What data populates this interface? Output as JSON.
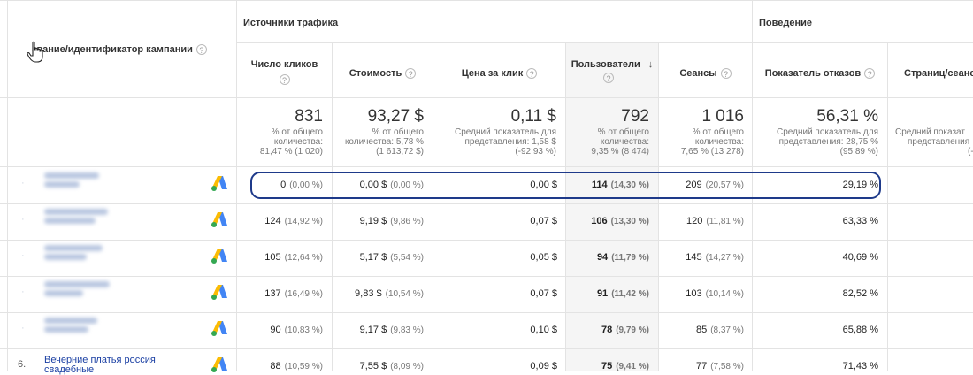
{
  "header": {
    "campaign_column": "Название/идентификатор кампании",
    "campaign_column_visible": "звание/идентификатор кампании",
    "groups": {
      "traffic_sources": "Источники трафика",
      "behavior": "Поведение"
    },
    "columns": {
      "clicks": "Число кликов",
      "cost": "Стоимость",
      "cpc": "Цена за клик",
      "users": "Пользователи",
      "sessions": "Сеансы",
      "bounce_rate": "Показатель отказов",
      "pages_per_session": "Страниц/сеанс"
    },
    "help_icon": "?",
    "sort_arrow": "↓"
  },
  "summary": {
    "clicks": {
      "value": "831",
      "sub1": "% от общего",
      "sub2": "количества:",
      "sub3": "81,47 % (1 020)"
    },
    "cost": {
      "value": "93,27 $",
      "sub1": "% от общего",
      "sub2": "количества: 5,78 %",
      "sub3": "(1 613,72 $)"
    },
    "cpc": {
      "value": "0,11 $",
      "sub1": "Средний показатель для",
      "sub2": "представления: 1,58 $",
      "sub3": "(-92,93 %)"
    },
    "users": {
      "value": "792",
      "sub1": "% от общего",
      "sub2": "количества:",
      "sub3": "9,35 % (8 474)"
    },
    "sessions": {
      "value": "1 016",
      "sub1": "% от общего",
      "sub2": "количества:",
      "sub3": "7,65 % (13 278)"
    },
    "bounce_rate": {
      "value": "56,31 %",
      "sub1": "Средний показатель для",
      "sub2": "представления: 28,75 %",
      "sub3": "(95,89 %)"
    },
    "pages_per_session": {
      "sub1": "Средний показат",
      "sub2": "представления",
      "sub3": "(-"
    }
  },
  "rows": [
    {
      "num": "",
      "clicks": "0",
      "clicks_pct": "(0,00 %)",
      "cost": "0,00 $",
      "cost_pct": "(0,00 %)",
      "cpc": "0,00 $",
      "users": "114",
      "users_pct": "(14,30 %)",
      "sessions": "209",
      "sessions_pct": "(20,57 %)",
      "bounce": "29,19 %"
    },
    {
      "num": "",
      "clicks": "124",
      "clicks_pct": "(14,92 %)",
      "cost": "9,19 $",
      "cost_pct": "(9,86 %)",
      "cpc": "0,07 $",
      "users": "106",
      "users_pct": "(13,30 %)",
      "sessions": "120",
      "sessions_pct": "(11,81 %)",
      "bounce": "63,33 %"
    },
    {
      "num": "",
      "clicks": "105",
      "clicks_pct": "(12,64 %)",
      "cost": "5,17 $",
      "cost_pct": "(5,54 %)",
      "cpc": "0,05 $",
      "users": "94",
      "users_pct": "(11,79 %)",
      "sessions": "145",
      "sessions_pct": "(14,27 %)",
      "bounce": "40,69 %"
    },
    {
      "num": "",
      "clicks": "137",
      "clicks_pct": "(16,49 %)",
      "cost": "9,83 $",
      "cost_pct": "(10,54 %)",
      "cpc": "0,07 $",
      "users": "91",
      "users_pct": "(11,42 %)",
      "sessions": "103",
      "sessions_pct": "(10,14 %)",
      "bounce": "82,52 %"
    },
    {
      "num": "",
      "clicks": "90",
      "clicks_pct": "(10,83 %)",
      "cost": "9,17 $",
      "cost_pct": "(9,83 %)",
      "cpc": "0,10 $",
      "users": "78",
      "users_pct": "(9,79 %)",
      "sessions": "85",
      "sessions_pct": "(8,37 %)",
      "bounce": "65,88 %"
    },
    {
      "num": "6.",
      "campaign": "Вечерние платья россия",
      "campaign2": "свадебные",
      "clicks": "88",
      "clicks_pct": "(10,59 %)",
      "cost": "7,55 $",
      "cost_pct": "(8,09 %)",
      "cpc": "0,09 $",
      "users": "75",
      "users_pct": "(9,41 %)",
      "sessions": "77",
      "sessions_pct": "(7,58 %)",
      "bounce": "71,43 %"
    }
  ],
  "colors": {
    "highlight": "#1e3a8a",
    "users_column_bg": "#f5f5f5",
    "google_ads_blue": "#4285f4",
    "google_ads_yellow": "#fbbc04"
  },
  "icons": {
    "google_ads": "google-ads-icon",
    "cursor": "hand-pointer-icon",
    "help": "help-circle-icon",
    "sort": "sort-desc-icon"
  }
}
